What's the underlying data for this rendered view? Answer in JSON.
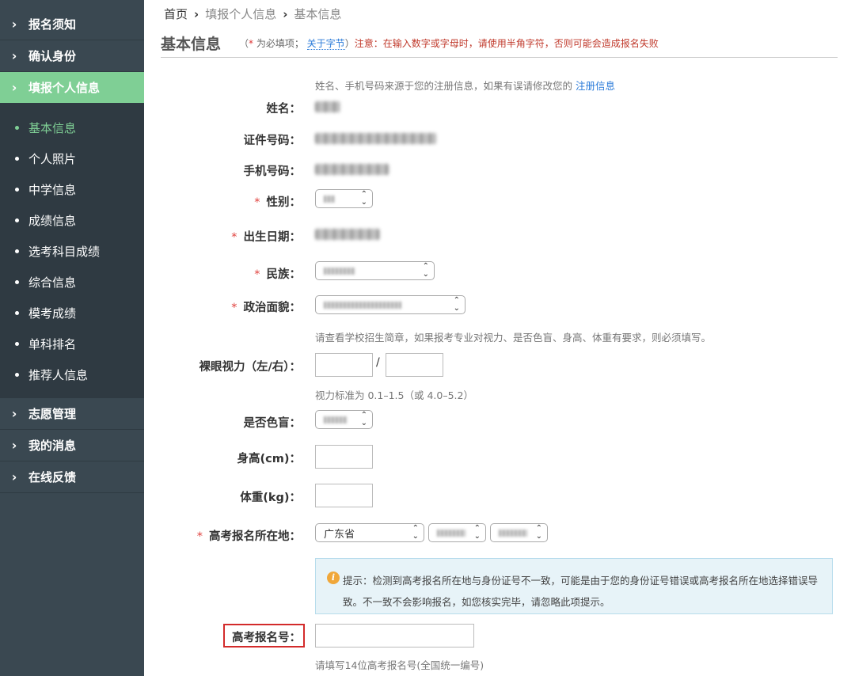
{
  "sidebar": {
    "top_items": [
      {
        "label": "报名须知"
      },
      {
        "label": "确认身份"
      },
      {
        "label": "填报个人信息"
      }
    ],
    "sub_items": [
      {
        "label": "基本信息"
      },
      {
        "label": "个人照片"
      },
      {
        "label": "中学信息"
      },
      {
        "label": "成绩信息"
      },
      {
        "label": "选考科目成绩"
      },
      {
        "label": "综合信息"
      },
      {
        "label": "模考成绩"
      },
      {
        "label": "单科排名"
      },
      {
        "label": "推荐人信息"
      }
    ],
    "bottom_items": [
      {
        "label": "志愿管理"
      },
      {
        "label": "我的消息"
      },
      {
        "label": "在线反馈"
      }
    ],
    "active_color": "#7fcf95"
  },
  "breadcrumb": {
    "home": "首页",
    "level1": "填报个人信息",
    "current": "基本信息"
  },
  "page": {
    "title": "基本信息",
    "notice_open": "（",
    "notice_star": "*",
    "notice_required": " 为必填项；",
    "notice_link": "关于字节",
    "notice_close": "）",
    "notice_warning": "注意：在输入数字或字母时，请使用半角字符，否则可能会造成报名失败"
  },
  "form": {
    "source_hint": "姓名、手机号码来源于您的注册信息，如果有误请修改您的",
    "source_hint_link": "注册信息",
    "name_label": "姓名：",
    "id_label": "证件号码：",
    "phone_label": "手机号码：",
    "gender_label": "性别：",
    "birth_label": "出生日期：",
    "ethnic_label": "民族：",
    "political_label": "政治面貌：",
    "school_hint": "请查看学校招生简章，如果报考专业对视力、是否色盲、身高、体重有要求，则必须填写。",
    "vision_label": "裸眼视力（左/右）：",
    "vision_slash": "/",
    "vision_hint": "视力标准为 0.1–1.5（或 4.0–5.2）",
    "colorblind_label": "是否色盲：",
    "height_label": "身高(cm)：",
    "weight_label": "体重(kg)：",
    "region_label": "高考报名所在地：",
    "province_value": "广东省",
    "tip_text": "提示：检测到高考报名所在地与身份证号不一致，可能是由于您的身份证号错误或高考报名所在地选择错误导致。不一致不会影响报名，如您核实完毕，请忽略此项提示。",
    "reg_no_label": "高考报名号：",
    "reg_no_hint": "请填写14位高考报名号(全国统一编号)",
    "required_mark": "*"
  }
}
